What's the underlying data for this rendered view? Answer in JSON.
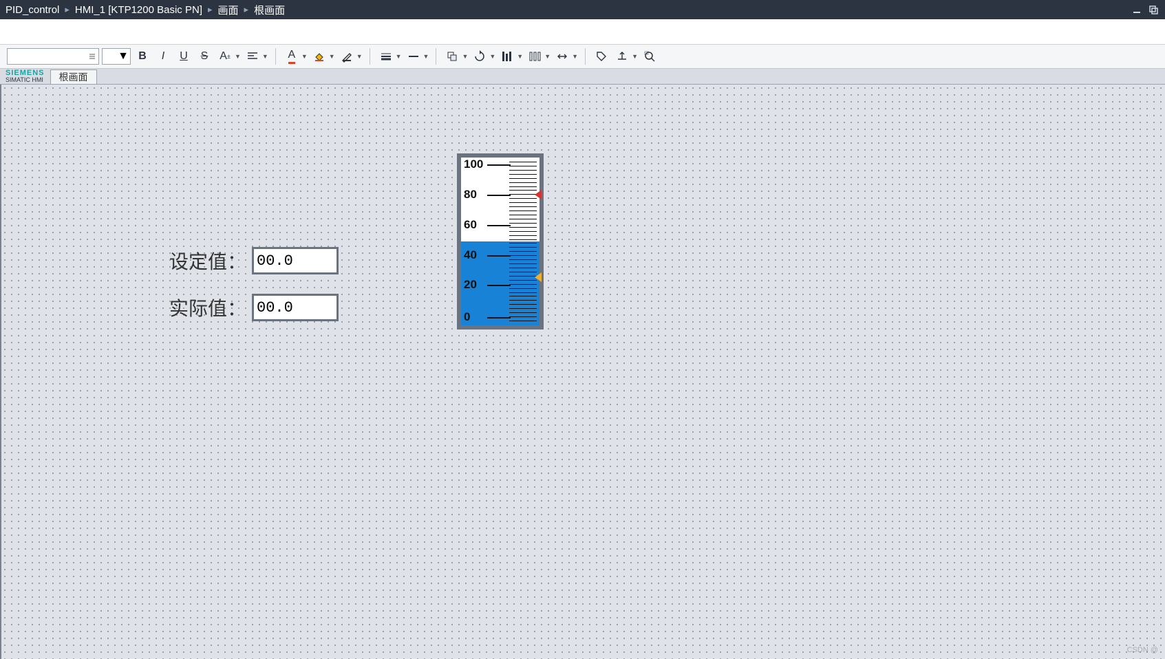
{
  "breadcrumb": {
    "item0": "PID_control",
    "item1": "HMI_1 [KTP1200 Basic PN]",
    "item2": "画面",
    "item3": "根画面",
    "sep": "▸"
  },
  "brand": {
    "line1": "SIEMENS",
    "line2": "SIMATIC HMI"
  },
  "tab": {
    "label": "根画面"
  },
  "fields": {
    "setpoint": {
      "label": "设定值：",
      "value": "00.0"
    },
    "actual": {
      "label": "实际值：",
      "value": "00.0"
    }
  },
  "gauge": {
    "min": 0,
    "max": 100,
    "fill_percent": 50,
    "ticks": [
      "100",
      "80",
      "60",
      "40",
      "20",
      "0"
    ],
    "marker_high_percent": 80,
    "marker_low_percent": 25
  },
  "watermark": "CSDN @"
}
